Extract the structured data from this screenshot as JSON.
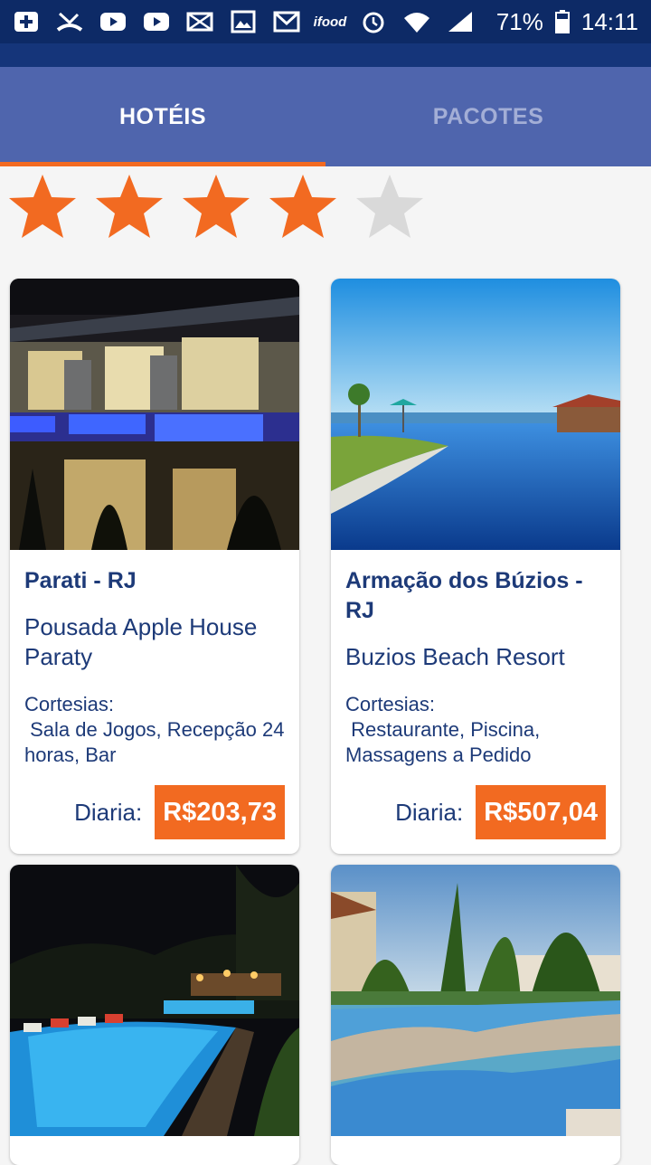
{
  "status": {
    "battery": "71%",
    "time": "14:11",
    "ifood_label": "ifood"
  },
  "tabs": [
    {
      "label": "HOTÉIS",
      "active": true
    },
    {
      "label": "PACOTES",
      "active": false
    }
  ],
  "rating": {
    "value": 4,
    "max": 5
  },
  "colors": {
    "accent": "#f26a21",
    "primary": "#4f65ad",
    "text": "#1d3a78"
  },
  "hotels": [
    {
      "city": "Parati - RJ",
      "name": "Pousada Apple House Paraty",
      "courtesy_label": "Cortesias:",
      "courtesy": " Sala de Jogos, Recepção 24 horas, Bar",
      "price_label": "Diaria:",
      "price": "R$203,73"
    },
    {
      "city": "Armação dos Búzios - RJ",
      "name": "Buzios Beach Resort",
      "courtesy_label": "Cortesias:",
      "courtesy": " Restaurante, Piscina, Massagens a Pedido",
      "price_label": "Diaria:",
      "price": "R$507,04"
    }
  ]
}
